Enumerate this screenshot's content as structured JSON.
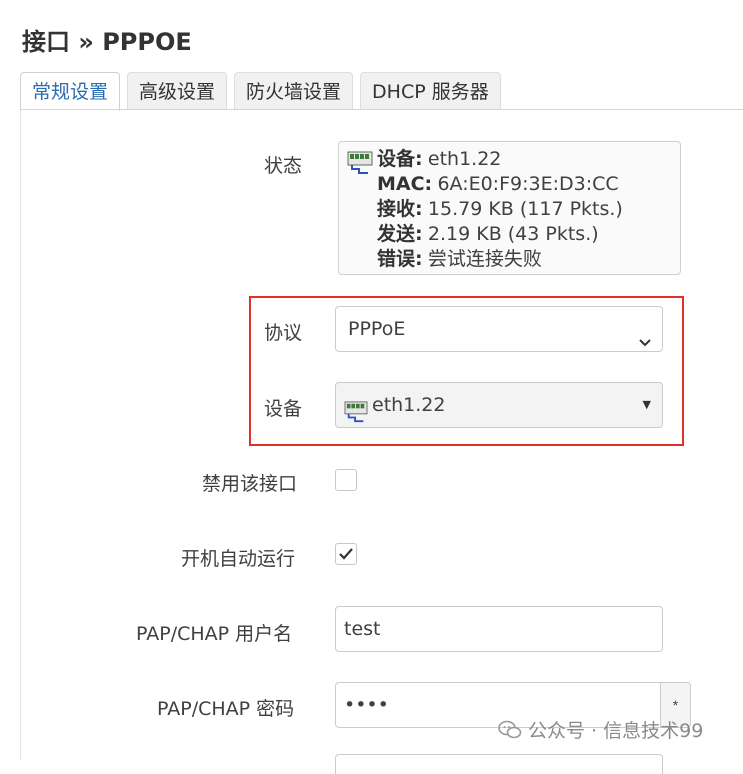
{
  "page": {
    "title": "接口 » PPPOE"
  },
  "tabs": [
    {
      "label": "常规设置",
      "active": true
    },
    {
      "label": "高级设置",
      "active": false
    },
    {
      "label": "防火墙设置",
      "active": false
    },
    {
      "label": "DHCP 服务器",
      "active": false
    }
  ],
  "status": {
    "label": "状态",
    "device_key": "设备:",
    "device_value": "eth1.22",
    "mac_key": "MAC:",
    "mac_value": "6A:E0:F9:3E:D3:CC",
    "rx_key": "接收:",
    "rx_value": "15.79 KB (117 Pkts.)",
    "tx_key": "发送:",
    "tx_value": "2.19 KB (43 Pkts.)",
    "error_key": "错误:",
    "error_value": "尝试连接失败"
  },
  "protocol": {
    "label": "协议",
    "value": "PPPoE"
  },
  "device": {
    "label": "设备",
    "value": "eth1.22"
  },
  "disable_interface": {
    "label": "禁用该接口",
    "checked": false
  },
  "autostart": {
    "label": "开机自动运行",
    "checked": true
  },
  "username": {
    "label": "PAP/CHAP 用户名",
    "value": "test"
  },
  "password": {
    "label": "PAP/CHAP 密码",
    "value": "••••",
    "reveal_label": "*"
  },
  "watermark": {
    "text": "公众号 · 信息技术99"
  },
  "colors": {
    "accent": "#2a6db0",
    "highlight": "#e0302a",
    "border": "#cccccc"
  }
}
